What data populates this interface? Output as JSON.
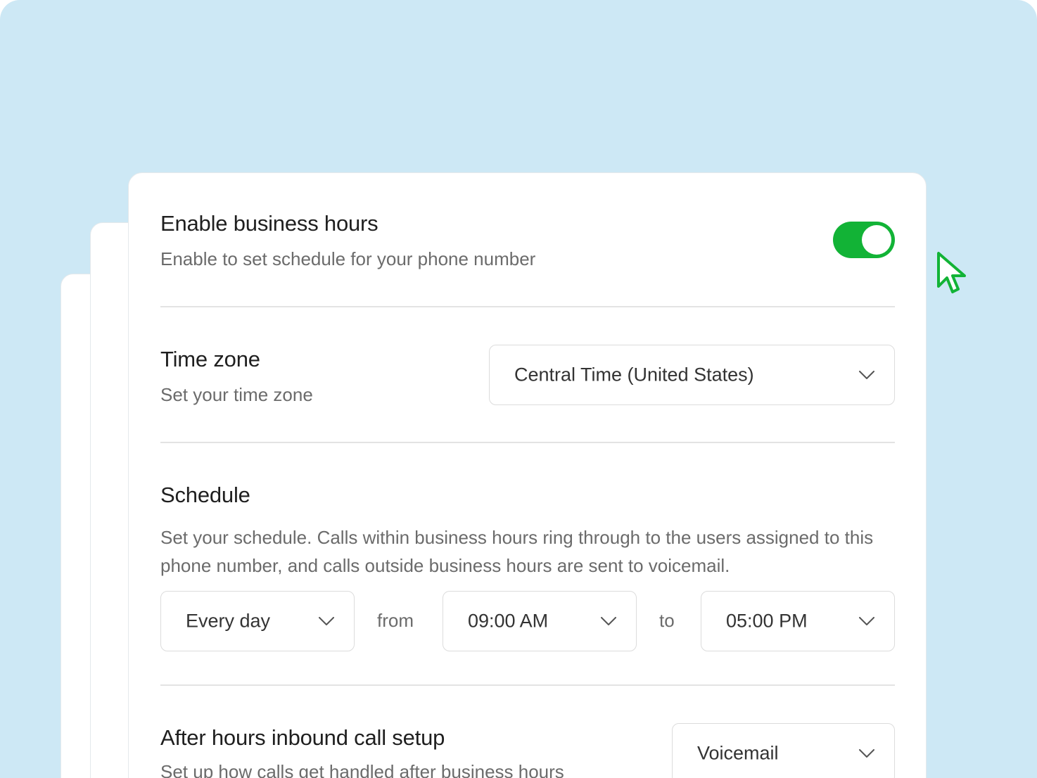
{
  "business_hours": {
    "title": "Enable business hours",
    "subtitle": "Enable to set schedule for your phone number",
    "enabled": true,
    "toggle_color": "#12b336"
  },
  "time_zone": {
    "title": "Time zone",
    "subtitle": "Set your time zone",
    "selected": "Central Time (United States)"
  },
  "schedule": {
    "title": "Schedule",
    "description": "Set your schedule. Calls within business hours ring through to the users assigned to this phone number, and calls outside business hours are sent to voicemail.",
    "days": "Every day",
    "from_label": "from",
    "start_time": "09:00 AM",
    "to_label": "to",
    "end_time": "05:00 PM"
  },
  "after_hours": {
    "title": "After hours inbound call setup",
    "subtitle": "Set up how calls get handled after business hours",
    "selected": "Voicemail"
  },
  "icons": {
    "chevron": "chevron-down-icon",
    "cursor": "mouse-pointer-icon"
  },
  "colors": {
    "background": "#cde8f5",
    "accent": "#12b336"
  }
}
